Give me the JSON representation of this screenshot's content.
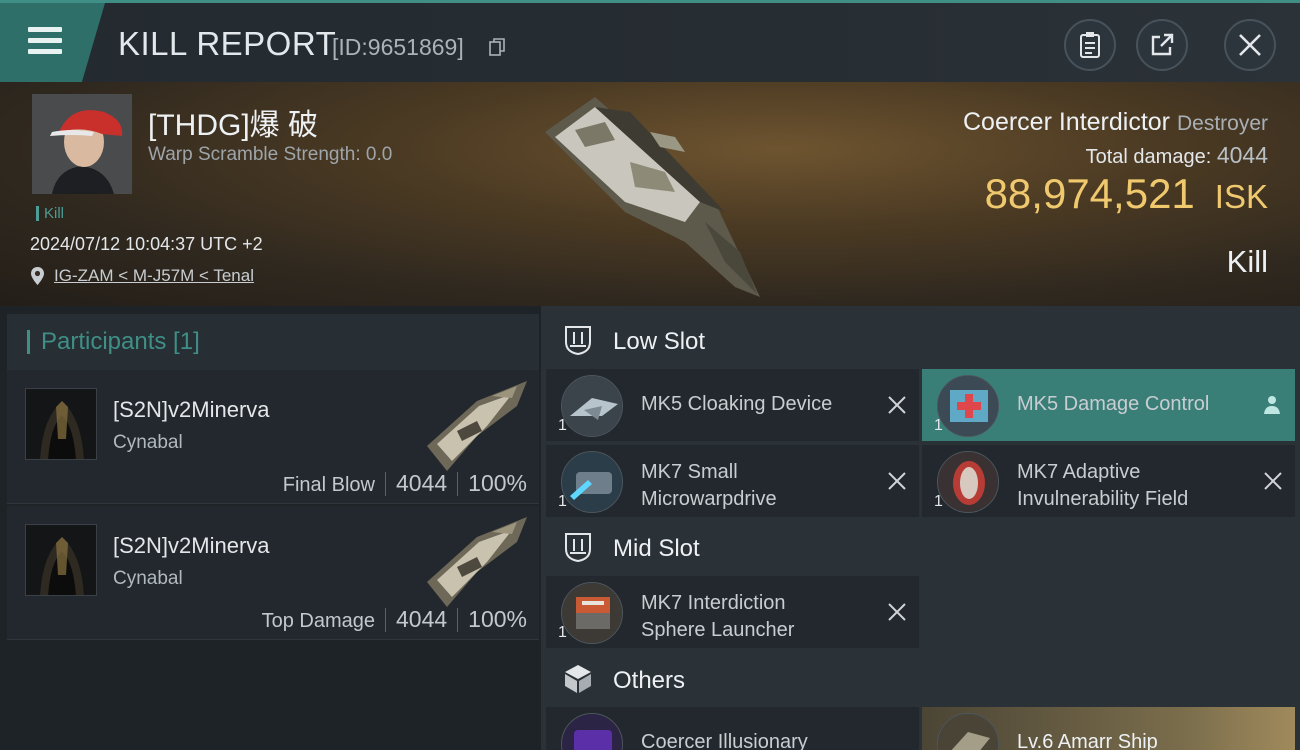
{
  "header": {
    "title": "KILL REPORT",
    "report_id": "[ID:9651869]",
    "icons": [
      "menu-icon",
      "copy-icon",
      "clipboard-icon",
      "share-icon",
      "close-icon"
    ]
  },
  "victim": {
    "name": "[THDG]爆 破",
    "warp_scramble": "Warp Scramble Strength: 0.0",
    "tag": "Kill",
    "datetime": "2024/07/12 10:04:37 UTC +2",
    "location": "IG-ZAM < M-J57M < Tenal"
  },
  "ship": {
    "name": "Coercer Interdictor",
    "class": "Destroyer",
    "total_damage_label": "Total damage:",
    "total_damage": "4044",
    "isk_value": "88,974,521",
    "isk_unit": "ISK",
    "result": "Kill"
  },
  "participants": {
    "header": "Participants [1]",
    "rows": [
      {
        "name": "[S2N]v2Minerva",
        "ship": "Cynabal",
        "role": "Final Blow",
        "damage": "4044",
        "percent": "100%"
      },
      {
        "name": "[S2N]v2Minerva",
        "ship": "Cynabal",
        "role": "Top Damage",
        "damage": "4044",
        "percent": "100%"
      }
    ]
  },
  "fitting": {
    "low_slot_label": "Low Slot",
    "mid_slot_label": "Mid Slot",
    "others_label": "Others",
    "low": [
      {
        "name": "MK5 Cloaking Device",
        "qty": "1",
        "state": "destroyed"
      },
      {
        "name": "MK5 Damage Control",
        "qty": "1",
        "state": "dropped"
      },
      {
        "name_line1": "MK7 Small",
        "name_line2": "Microwarpdrive",
        "qty": "1",
        "state": "destroyed"
      },
      {
        "name_line1": "MK7 Adaptive",
        "name_line2": "Invulnerability Field",
        "qty": "1",
        "state": "destroyed"
      }
    ],
    "mid": [
      {
        "name_line1": "MK7 Interdiction",
        "name_line2": "Sphere Launcher",
        "qty": "1",
        "state": "destroyed"
      }
    ],
    "others": [
      {
        "name": "Coercer Illusionary"
      },
      {
        "name": "Lv.6 Amarr Ship"
      }
    ]
  },
  "colors": {
    "accent_teal": "#3f8f86",
    "isk_gold": "#f0c96e",
    "dropped_highlight": "#3a7e78"
  }
}
